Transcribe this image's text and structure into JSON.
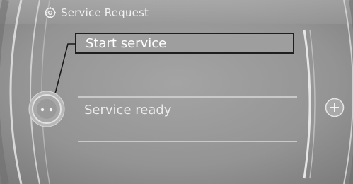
{
  "header": {
    "title": "Service Request",
    "icon": "service-icon"
  },
  "menu": {
    "items": [
      {
        "label": "Start service",
        "selected": true
      },
      {
        "label": "Service ready",
        "selected": false
      }
    ]
  },
  "controls": {
    "controller_icon": "controller-knob-icon",
    "plus_icon": "plus-icon"
  },
  "colors": {
    "background": "#8f8f8f",
    "highlight_border": "#1e1e1e",
    "text": "#f4f4f4"
  }
}
